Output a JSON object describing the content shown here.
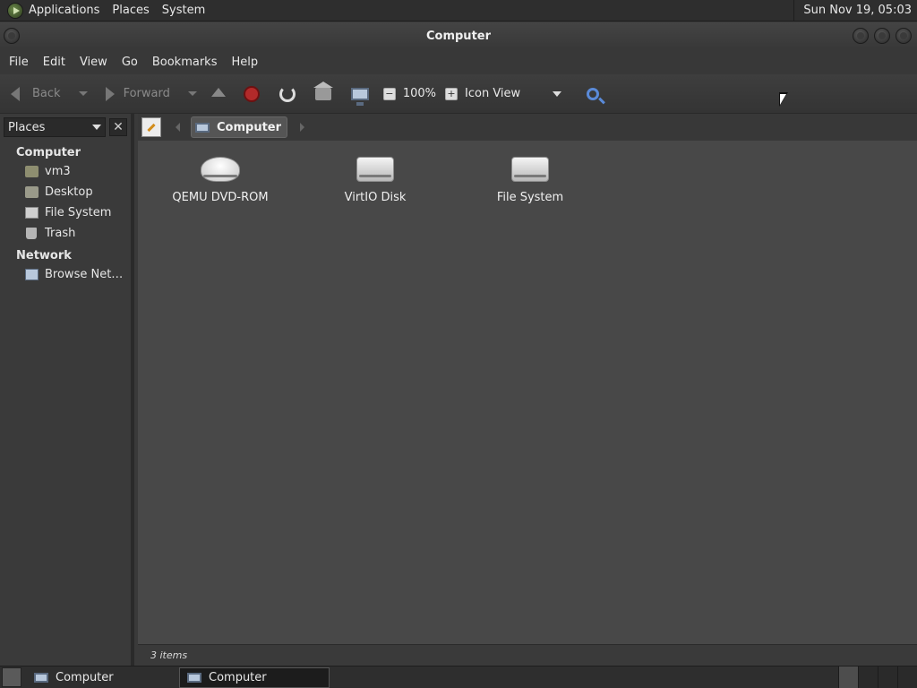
{
  "top_panel": {
    "menus": [
      "Applications",
      "Places",
      "System"
    ],
    "clock": "Sun Nov 19, 05:03"
  },
  "window": {
    "title": "Computer"
  },
  "menubar": [
    "File",
    "Edit",
    "View",
    "Go",
    "Bookmarks",
    "Help"
  ],
  "toolbar": {
    "back_label": "Back",
    "forward_label": "Forward",
    "zoom": "100%",
    "view_mode": "Icon View"
  },
  "sidebar": {
    "selector_label": "Places",
    "sections": [
      {
        "heading": "Computer",
        "items": [
          {
            "label": "vm3",
            "icon": "home-folder-icon"
          },
          {
            "label": "Desktop",
            "icon": "desktop-folder-icon"
          },
          {
            "label": "File System",
            "icon": "drive-icon"
          },
          {
            "label": "Trash",
            "icon": "trash-icon"
          }
        ]
      },
      {
        "heading": "Network",
        "items": [
          {
            "label": "Browse Net…",
            "icon": "network-icon"
          }
        ]
      }
    ]
  },
  "location": {
    "crumb": "Computer"
  },
  "files": [
    {
      "label": "QEMU DVD-ROM",
      "icon": "dvd-drive-icon"
    },
    {
      "label": "VirtIO Disk",
      "icon": "hard-disk-icon"
    },
    {
      "label": "File System",
      "icon": "hard-disk-icon"
    }
  ],
  "status": {
    "text": "3 items"
  },
  "taskbar": {
    "tasks": [
      "Computer",
      "Computer"
    ]
  }
}
